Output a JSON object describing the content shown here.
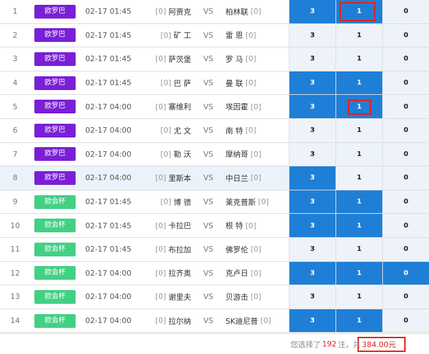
{
  "colors": {
    "euro_league": "#7a1fd6",
    "conference": "#42d184",
    "selected": "#1f7fd6",
    "unselected": "#edf3f9",
    "highlight_box": "#e02020"
  },
  "matches": [
    {
      "num": "1",
      "league": "欧罗巴",
      "time": "02-17 01:45",
      "home_rank": "[0]",
      "home": "阿贾克",
      "vs": "VS",
      "away": "柏林联",
      "away_rank": "[0]",
      "o3": "3",
      "o1": "1",
      "o0": "0"
    },
    {
      "num": "2",
      "league": "欧罗巴",
      "time": "02-17 01:45",
      "home_rank": "[0]",
      "home": "矿 工",
      "vs": "VS",
      "away": "雷 恩",
      "away_rank": "[0]",
      "o3": "3",
      "o1": "1",
      "o0": "0"
    },
    {
      "num": "3",
      "league": "欧罗巴",
      "time": "02-17 01:45",
      "home_rank": "[0]",
      "home": "萨茨堡",
      "vs": "VS",
      "away": "罗 马",
      "away_rank": "[0]",
      "o3": "3",
      "o1": "1",
      "o0": "0"
    },
    {
      "num": "4",
      "league": "欧罗巴",
      "time": "02-17 01:45",
      "home_rank": "[0]",
      "home": "巴 萨",
      "vs": "VS",
      "away": "曼 联",
      "away_rank": "[0]",
      "o3": "3",
      "o1": "1",
      "o0": "0"
    },
    {
      "num": "5",
      "league": "欧罗巴",
      "time": "02-17 04:00",
      "home_rank": "[0]",
      "home": "塞维利",
      "vs": "VS",
      "away": "埃因霍",
      "away_rank": "[0]",
      "o3": "3",
      "o1": "1",
      "o0": "0"
    },
    {
      "num": "6",
      "league": "欧罗巴",
      "time": "02-17 04:00",
      "home_rank": "[0]",
      "home": "尤 文",
      "vs": "VS",
      "away": "南 特",
      "away_rank": "[0]",
      "o3": "3",
      "o1": "1",
      "o0": "0"
    },
    {
      "num": "7",
      "league": "欧罗巴",
      "time": "02-17 04:00",
      "home_rank": "[0]",
      "home": "勒 沃",
      "vs": "VS",
      "away": "摩纳哥",
      "away_rank": "[0]",
      "o3": "3",
      "o1": "1",
      "o0": "0"
    },
    {
      "num": "8",
      "league": "欧罗巴",
      "time": "02-17 04:00",
      "home_rank": "[0]",
      "home": "里斯本",
      "vs": "VS",
      "away": "中日兰",
      "away_rank": "[0]",
      "o3": "3",
      "o1": "1",
      "o0": "0"
    },
    {
      "num": "9",
      "league": "欧会杯",
      "time": "02-17 01:45",
      "home_rank": "[0]",
      "home": "博 德",
      "vs": "VS",
      "away": "莱克普斯",
      "away_rank": "[0]",
      "o3": "3",
      "o1": "1",
      "o0": "0"
    },
    {
      "num": "10",
      "league": "欧会杯",
      "time": "02-17 01:45",
      "home_rank": "[0]",
      "home": "卡拉巴",
      "vs": "VS",
      "away": "根 特",
      "away_rank": "[0]",
      "o3": "3",
      "o1": "1",
      "o0": "0"
    },
    {
      "num": "11",
      "league": "欧会杯",
      "time": "02-17 01:45",
      "home_rank": "[0]",
      "home": "布拉加",
      "vs": "VS",
      "away": "佛罗伦",
      "away_rank": "[0]",
      "o3": "3",
      "o1": "1",
      "o0": "0"
    },
    {
      "num": "12",
      "league": "欧会杯",
      "time": "02-17 04:00",
      "home_rank": "[0]",
      "home": "拉齐奥",
      "vs": "VS",
      "away": "克卢日",
      "away_rank": "[0]",
      "o3": "3",
      "o1": "1",
      "o0": "0"
    },
    {
      "num": "13",
      "league": "欧会杯",
      "time": "02-17 04:00",
      "home_rank": "[0]",
      "home": "谢里夫",
      "vs": "VS",
      "away": "贝游击",
      "away_rank": "[0]",
      "o3": "3",
      "o1": "1",
      "o0": "0"
    },
    {
      "num": "14",
      "league": "欧会杯",
      "time": "02-17 04:00",
      "home_rank": "[0]",
      "home": "拉尔纳",
      "vs": "VS",
      "away": "SK迪尼普",
      "away_rank": "[0]",
      "o3": "3",
      "o1": "1",
      "o0": "0"
    }
  ],
  "footer": {
    "prefix": "您选择了",
    "count": "192",
    "mid": "注，共",
    "amount": "384.00元"
  }
}
